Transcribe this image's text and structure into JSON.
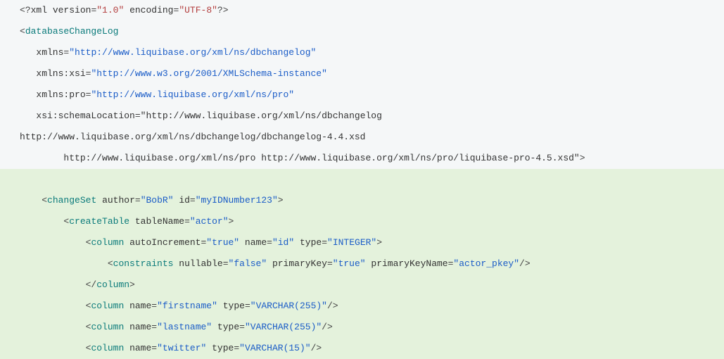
{
  "xml_decl": {
    "version_attr": "version",
    "version_val": "\"1.0\"",
    "encoding_attr": "encoding",
    "encoding_val": "\"UTF-8\""
  },
  "root": {
    "tag": "databaseChangeLog",
    "xmlns_attr": "xmlns",
    "xmlns_val": "\"http://www.liquibase.org/xml/ns/dbchangelog\"",
    "xmlns_xsi_attr": "xmlns:xsi",
    "xmlns_xsi_val": "\"http://www.w3.org/2001/XMLSchema-instance\"",
    "xmlns_pro_attr": "xmlns:pro",
    "xmlns_pro_val": "\"http://www.liquibase.org/xml/ns/pro\"",
    "schema_loc_attr": "xsi:schemaLocation",
    "schema_loc_part1": "\"http://www.liquibase.org/xml/ns/dbchangelog",
    "schema_loc_part2": "http://www.liquibase.org/xml/ns/dbchangelog/dbchangelog-4.4.xsd",
    "schema_loc_part3": "        http://www.liquibase.org/xml/ns/pro http://www.liquibase.org/xml/ns/pro/liquibase-pro-4.5.xsd\""
  },
  "changeset": {
    "tag": "changeSet",
    "author_attr": "author",
    "author_val": "\"BobR\"",
    "id_attr": "id",
    "id_val": "\"myIDNumber123\""
  },
  "createtable": {
    "tag": "createTable",
    "tablename_attr": "tableName",
    "tablename_val": "\"actor\""
  },
  "col1": {
    "tag": "column",
    "autoinc_attr": "autoIncrement",
    "autoinc_val": "\"true\"",
    "name_attr": "name",
    "name_val": "\"id\"",
    "type_attr": "type",
    "type_val": "\"INTEGER\"",
    "close_tag": "column"
  },
  "constraints": {
    "tag": "constraints",
    "nullable_attr": "nullable",
    "nullable_val": "\"false\"",
    "pk_attr": "primaryKey",
    "pk_val": "\"true\"",
    "pkname_attr": "primaryKeyName",
    "pkname_val": "\"actor_pkey\""
  },
  "col2": {
    "tag": "column",
    "name_attr": "name",
    "name_val": "\"firstname\"",
    "type_attr": "type",
    "type_val": "\"VARCHAR(255)\""
  },
  "col3": {
    "tag": "column",
    "name_attr": "name",
    "name_val": "\"lastname\"",
    "type_attr": "type",
    "type_val": "\"VARCHAR(255)\""
  },
  "col4": {
    "tag": "column",
    "name_attr": "name",
    "name_val": "\"twitter\"",
    "type_attr": "type",
    "type_val": "\"VARCHAR(15)\""
  }
}
